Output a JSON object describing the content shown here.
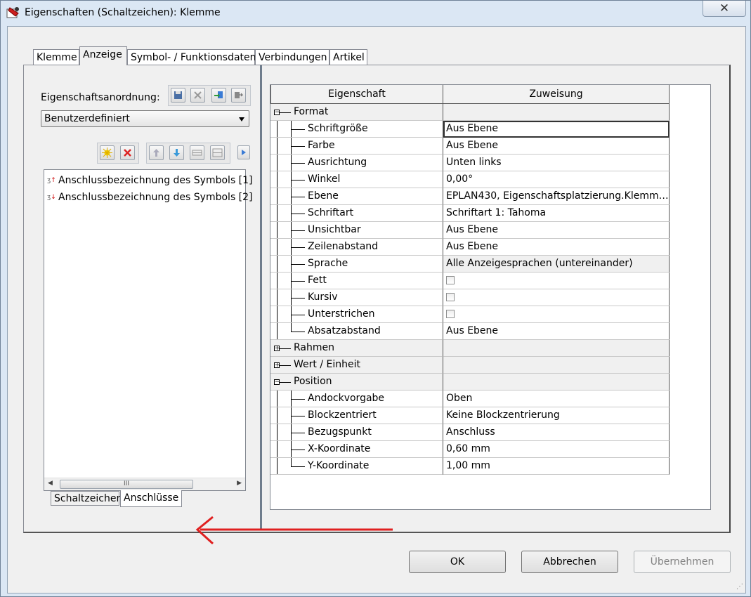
{
  "window": {
    "title": "Eigenschaften (Schaltzeichen): Klemme",
    "close_label": "✕"
  },
  "tabs": [
    {
      "label": "Klemme",
      "active": false
    },
    {
      "label": "Anzeige",
      "active": true
    },
    {
      "label": "Symbol- / Funktionsdaten",
      "active": false
    },
    {
      "label": "Verbindungen",
      "active": false
    },
    {
      "label": "Artikel",
      "active": false
    }
  ],
  "left_panel": {
    "arrangement_label": "Eigenschaftsanordnung:",
    "arrangement_value": "Benutzerdefiniert",
    "arrangement_tools": [
      "save-icon",
      "delete-icon",
      "import-icon",
      "export-icon"
    ],
    "list_tools": [
      "new-icon",
      "delete-icon",
      "move-up-icon",
      "move-down-icon",
      "merge-icon",
      "split-icon",
      "more-icon"
    ],
    "list_items": [
      {
        "icon": "connection-up-icon",
        "label": "Anschlussbezeichnung des Symbols [1]"
      },
      {
        "icon": "connection-down-icon",
        "label": "Anschlussbezeichnung des Symbols [2]"
      }
    ],
    "scroll_grip": "III",
    "subtabs": [
      {
        "label": "Schaltzeichen",
        "active": false
      },
      {
        "label": "Anschlüsse",
        "active": true
      }
    ]
  },
  "grid": {
    "col_property": "Eigenschaft",
    "col_value": "Zuweisung",
    "rows": [
      {
        "name": "Format",
        "value": "",
        "level": 0,
        "group": true,
        "expanded": true
      },
      {
        "name": "Schriftgröße",
        "value": "Aus Ebene",
        "level": 1,
        "selected": true
      },
      {
        "name": "Farbe",
        "value": "Aus Ebene",
        "level": 1
      },
      {
        "name": "Ausrichtung",
        "value": "Unten links",
        "level": 1
      },
      {
        "name": "Winkel",
        "value": "0,00°",
        "level": 1
      },
      {
        "name": "Ebene",
        "value": "EPLAN430, Eigenschaftsplatzierung.Klemmen-...",
        "level": 1
      },
      {
        "name": "Schriftart",
        "value": "Schriftart 1: Tahoma",
        "level": 1
      },
      {
        "name": "Unsichtbar",
        "value": "Aus Ebene",
        "level": 1
      },
      {
        "name": "Zeilenabstand",
        "value": "Aus Ebene",
        "level": 1
      },
      {
        "name": "Sprache",
        "value": "Alle Anzeigesprachen (untereinander)",
        "level": 1,
        "shaded": true
      },
      {
        "name": "Fett",
        "value": "",
        "level": 1,
        "checkbox": true
      },
      {
        "name": "Kursiv",
        "value": "",
        "level": 1,
        "checkbox": true
      },
      {
        "name": "Unterstrichen",
        "value": "",
        "level": 1,
        "checkbox": true
      },
      {
        "name": "Absatzabstand",
        "value": "Aus Ebene",
        "level": 1,
        "last": true
      },
      {
        "name": "Rahmen",
        "value": "",
        "level": 0,
        "group": true,
        "expanded": false
      },
      {
        "name": "Wert / Einheit",
        "value": "",
        "level": 0,
        "group": true,
        "expanded": false
      },
      {
        "name": "Position",
        "value": "",
        "level": 0,
        "group": true,
        "expanded": true
      },
      {
        "name": "Andockvorgabe",
        "value": "Oben",
        "level": 1
      },
      {
        "name": "Blockzentriert",
        "value": "Keine Blockzentrierung",
        "level": 1
      },
      {
        "name": "Bezugspunkt",
        "value": "Anschluss",
        "level": 1
      },
      {
        "name": "X-Koordinate",
        "value": "0,60 mm",
        "level": 1
      },
      {
        "name": "Y-Koordinate",
        "value": "1,00 mm",
        "level": 1,
        "last": true
      }
    ]
  },
  "buttons": {
    "ok": "OK",
    "cancel": "Abbrechen",
    "apply": "Übernehmen"
  },
  "annotation_color": "#e02020"
}
